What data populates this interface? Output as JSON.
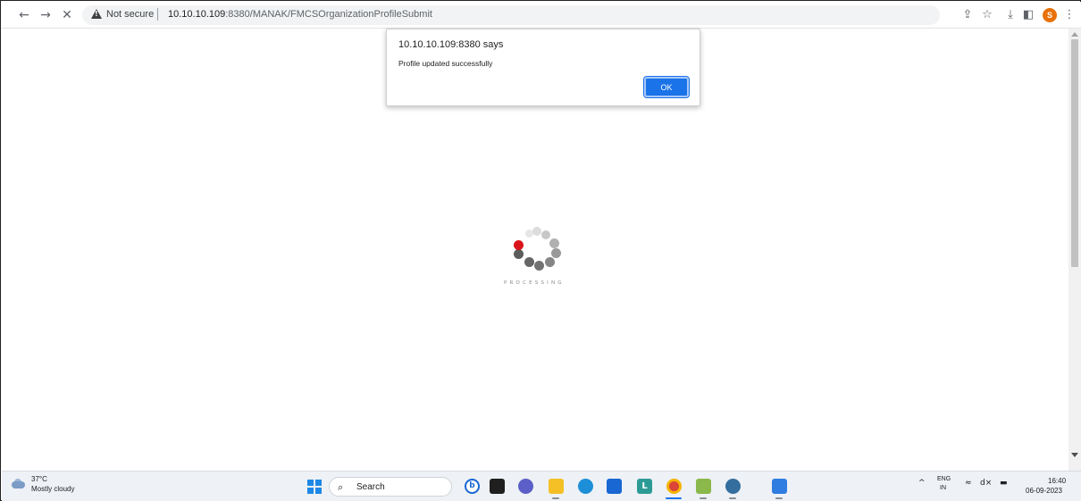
{
  "browser": {
    "back_icon": "arrow-left-icon",
    "forward_icon": "arrow-right-icon",
    "stop_icon": "close-icon",
    "security_label": "Not secure",
    "url_host": "10.10.10.109",
    "url_rest": ":8380/MANAK/FMCSOrganizationProfileSubmit",
    "avatar_letter": "S"
  },
  "dialog": {
    "title": "10.10.10.109:8380 says",
    "message": "Profile updated successfully",
    "ok_label": "OK"
  },
  "loader": {
    "label": "PROCESSING",
    "accent": "#d9141a"
  },
  "taskbar": {
    "weather_temp": "37°C",
    "weather_condition": "Mostly cloudy",
    "search_placeholder": "Search",
    "lang_primary": "ENG",
    "lang_secondary": "IN",
    "time": "16:40",
    "date": "06-09-2023"
  }
}
